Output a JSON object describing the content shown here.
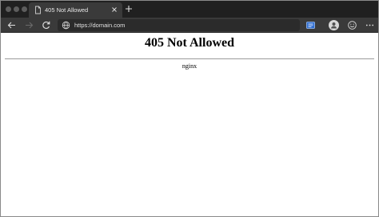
{
  "browser": {
    "tab": {
      "title": "405 Not Allowed",
      "favicon": "page-icon"
    },
    "toolbar": {
      "url": "https://domain.com"
    },
    "colors": {
      "tabbar": "#202020",
      "toolbar": "#3a3a3a",
      "address_bar": "#2b2b2b"
    }
  },
  "page": {
    "heading": "405 Not Allowed",
    "server": "nginx"
  }
}
